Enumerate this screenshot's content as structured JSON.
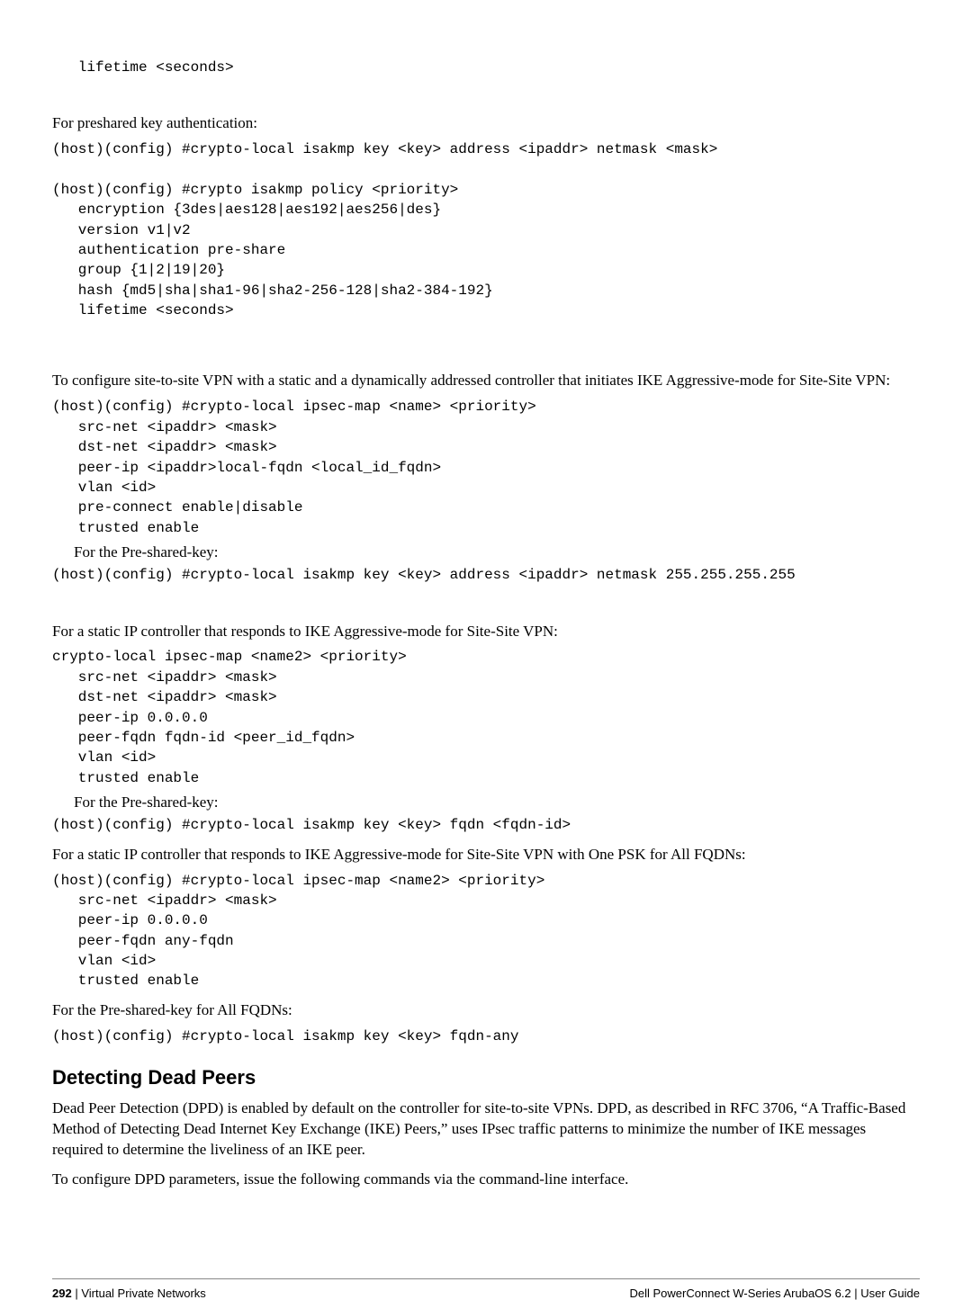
{
  "code1": "   lifetime <seconds>",
  "para1": "For preshared key authentication:",
  "code2": "(host)(config) #crypto-local isakmp key <key> address <ipaddr> netmask <mask>",
  "code3": "(host)(config) #crypto isakmp policy <priority>\n   encryption {3des|aes128|aes192|aes256|des}\n   version v1|v2\n   authentication pre-share\n   group {1|2|19|20}\n   hash {md5|sha|sha1-96|sha2-256-128|sha2-384-192}\n   lifetime <seconds>",
  "para2": "To configure site-to-site VPN with a static and a dynamically addressed controller that initiates IKE Aggressive-mode for Site-Site VPN:",
  "code4": "(host)(config) #crypto-local ipsec-map <name> <priority>\n   src-net <ipaddr> <mask>\n   dst-net <ipaddr> <mask>\n   peer-ip <ipaddr>local-fqdn <local_id_fqdn>\n   vlan <id>\n   pre-connect enable|disable\n   trusted enable",
  "sub1": "For the Pre-shared-key:",
  "code5": "(host)(config) #crypto-local isakmp key <key> address <ipaddr> netmask 255.255.255.255",
  "para3": "For a static IP controller that responds to IKE Aggressive-mode for Site-Site VPN:",
  "code6": "crypto-local ipsec-map <name2> <priority>\n   src-net <ipaddr> <mask>\n   dst-net <ipaddr> <mask>\n   peer-ip 0.0.0.0\n   peer-fqdn fqdn-id <peer_id_fqdn>\n   vlan <id>\n   trusted enable",
  "sub2": "For the Pre-shared-key:",
  "code7": "(host)(config) #crypto-local isakmp key <key> fqdn <fqdn-id>",
  "para4": "For a static IP controller that responds to IKE Aggressive-mode for Site-Site VPN with One PSK for All FQDNs:",
  "code8": "(host)(config) #crypto-local ipsec-map <name2> <priority>\n   src-net <ipaddr> <mask>\n   peer-ip 0.0.0.0\n   peer-fqdn any-fqdn\n   vlan <id>\n   trusted enable",
  "para5": "For the Pre-shared-key for All FQDNs:",
  "code9": "(host)(config) #crypto-local isakmp key <key> fqdn-any",
  "heading": "Detecting Dead Peers",
  "para6": "Dead Peer Detection (DPD) is enabled by default on the controller for site-to-site VPNs. DPD, as described in RFC 3706, “A Traffic-Based Method of Detecting Dead Internet Key Exchange (IKE) Peers,” uses IPsec traffic patterns to minimize the number of IKE messages required to determine the liveliness of an IKE peer.",
  "para7": "To configure DPD parameters, issue the following commands via the command-line interface.",
  "footer": {
    "page": "292",
    "section": "Virtual Private Networks",
    "right": "Dell PowerConnect W-Series ArubaOS 6.2  |  User Guide"
  }
}
